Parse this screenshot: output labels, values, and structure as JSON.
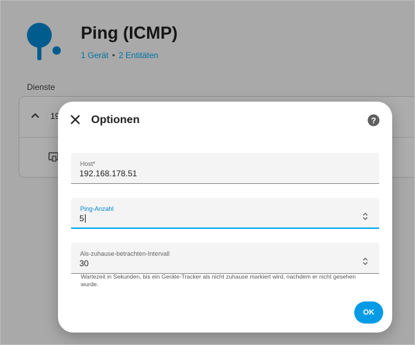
{
  "header": {
    "title": "Ping (ICMP)",
    "device_link": "1 Gerät",
    "separator": "•",
    "entities_link": "2 Entitäten",
    "icon": "ping-pong-icon",
    "icon_color": "#0288d1"
  },
  "services": {
    "label": "Dienste",
    "entry_text": "19"
  },
  "dialog": {
    "title": "Optionen",
    "close_icon": "close-icon",
    "help_icon": "help-circle-icon",
    "fields": [
      {
        "label": "Host*",
        "value": "192.168.178.51"
      },
      {
        "label": "Ping-Anzahl",
        "value": "5"
      },
      {
        "label": "Als-zuhause-betrachten-Intervall",
        "value": "30"
      }
    ],
    "helper_text": "Wartezeit in Sekunden, bis ein Geräte-Tracker als nicht zuhause markiert wird, nachdem er nicht gesehen wurde.",
    "ok_label": "OK",
    "accent_color": "#03a9f4"
  }
}
